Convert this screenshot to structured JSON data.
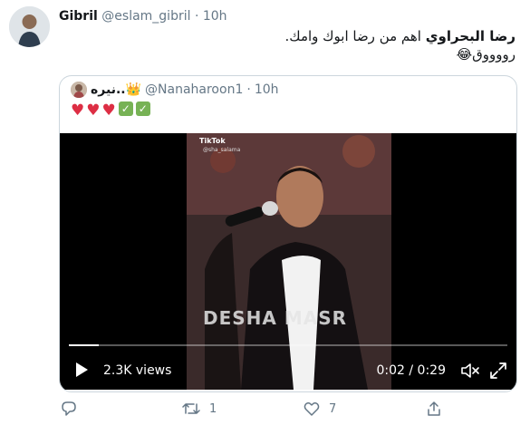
{
  "tweet": {
    "author_name": "Gibril",
    "handle": "@eslam_gibril",
    "separator": "·",
    "time": "10h",
    "text_bold": "رضا البحراوي",
    "text_rest": " اهم من رضا ابوك وامك.",
    "text_line2": "رووووق😂"
  },
  "quote": {
    "author_name": "نيره..👑",
    "handle": "@Nanaharoon1",
    "separator": "·",
    "time": "10h",
    "hearts": [
      "♥",
      "♥",
      "♥"
    ],
    "checks": [
      "✓",
      "✓"
    ],
    "video": {
      "overlay_app": "TikTok",
      "overlay_user": "@sha_salama",
      "watermark": "DESHA MASR",
      "views": "2.3K views",
      "time_display": "0:02 / 0:29",
      "progress": 0.069,
      "icons": [
        "play-icon",
        "mute-icon",
        "fullscreen-icon"
      ]
    }
  },
  "actions": {
    "reply_count": "",
    "retweet_count": "1",
    "like_count": "7",
    "icons": [
      "reply-icon",
      "retweet-icon",
      "like-icon",
      "share-icon"
    ]
  },
  "colors": {
    "text_primary": "#14171a",
    "text_secondary": "#657786",
    "border": "#ccd6dd",
    "heart": "#dd2e44",
    "check": "#77b255"
  }
}
